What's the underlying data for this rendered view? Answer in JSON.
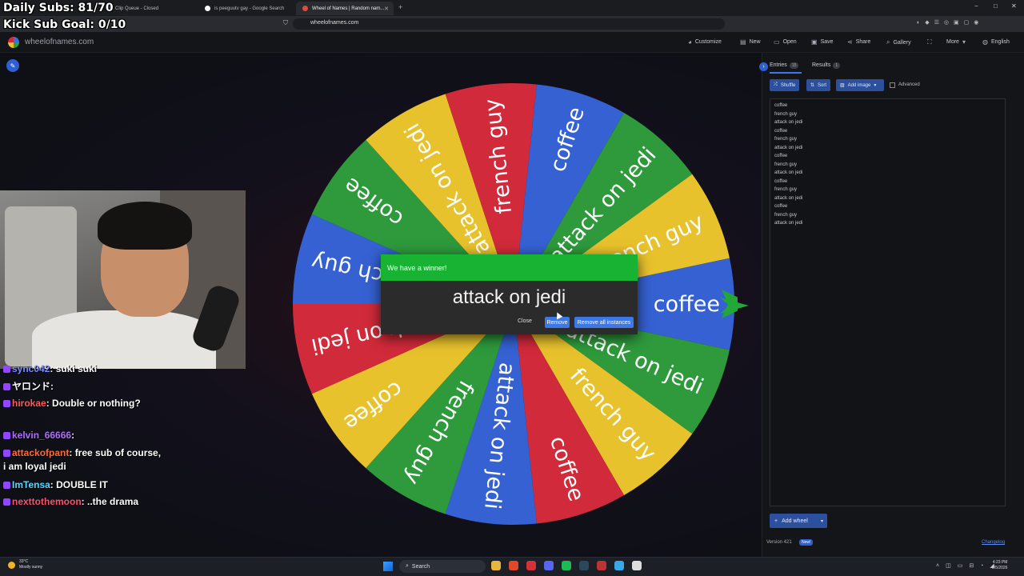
{
  "stream": {
    "daily_subs": "Daily Subs: 81/70",
    "kick_goal": "Kick Sub Goal: 0/10"
  },
  "browser": {
    "tabs": [
      {
        "label": "Clip Queue - Closed",
        "icon_color": "#6a5acd"
      },
      {
        "label": "is peeguutv gay - Google Search",
        "icon_color": "#ffffff"
      },
      {
        "label": "Wheel of Names | Random nam...",
        "icon_color": "#e24a3a"
      }
    ],
    "new_tab": "+",
    "url": "wheelofnames.com",
    "window_controls": [
      "−",
      "□",
      "✕"
    ]
  },
  "site": {
    "name": "wheelofnames.com",
    "menu": [
      {
        "label": "Customize",
        "icon": "palette-icon"
      },
      {
        "label": "New",
        "icon": "file-icon"
      },
      {
        "label": "Open",
        "icon": "folder-icon"
      },
      {
        "label": "Save",
        "icon": "save-icon"
      },
      {
        "label": "Share",
        "icon": "share-icon"
      },
      {
        "label": "Gallery",
        "icon": "search-icon"
      },
      {
        "label": "",
        "icon": "fullscreen-icon"
      },
      {
        "label": "More",
        "icon": "chevron-down-icon"
      },
      {
        "label": "English",
        "icon": "globe-icon"
      }
    ]
  },
  "wheel": {
    "colors": [
      "#3561d2",
      "#2e9a3c",
      "#e8c22c",
      "#d12a3a"
    ],
    "segments": [
      "coffee",
      "attack on jedi",
      "french guy",
      "coffee",
      "attack on jedi",
      "french guy",
      "coffee",
      "attack on jedi",
      "french guy",
      "coffee",
      "attack on jedi",
      "french guy",
      "coffee",
      "attack on jedi",
      "french guy"
    ]
  },
  "dialog": {
    "title": "We have a winner!",
    "winner": "attack on jedi",
    "close": "Close",
    "remove": "Remove",
    "remove_all": "Remove all instances"
  },
  "panel": {
    "tabs": {
      "entries": "Entries",
      "entries_count": "15",
      "results": "Results",
      "results_count": "1"
    },
    "shuffle": "Shuffle",
    "sort": "Sort",
    "add_image": "Add image",
    "advanced": "Advanced",
    "entries": [
      "coffee",
      "french guy",
      "attack on jedi",
      "coffee",
      "french guy",
      "attack on jedi",
      "coffee",
      "french guy",
      "attack on jedi",
      "coffee",
      "french guy",
      "attack on jedi",
      "coffee",
      "french guy",
      "attack on jedi"
    ],
    "add_wheel": "Add wheel",
    "version": "Version 421",
    "new_badge": "New!",
    "changelog": "Changelog"
  },
  "chat": [
    {
      "user": "sync042",
      "message": "suki suki",
      "color": "#7b8cff"
    },
    {
      "user": "",
      "message": "ヤロンド:",
      "color": "#ffffff"
    },
    {
      "user": "hirokae",
      "message": "Double or nothing?",
      "color": "#ff5a5a"
    },
    {
      "user": "kelvin_66666",
      "message": "",
      "color": "#b06cff"
    },
    {
      "user": "attackofpant",
      "message": "free sub of course,",
      "color": "#ff6a3a"
    },
    {
      "user": "",
      "message": "i am loyal jedi",
      "color": "#ffffff"
    },
    {
      "user": "ImTensa",
      "message": "DOUBLE IT",
      "color": "#5ad6ff"
    },
    {
      "user": "nexttothemoon",
      "message": "..the drama",
      "color": "#ff4f6e"
    }
  ],
  "taskbar": {
    "weather_temp": "33°C",
    "weather_desc": "Mostly sunny",
    "search": "Search",
    "time": "4:23 PM",
    "date": "8/5/2026"
  }
}
